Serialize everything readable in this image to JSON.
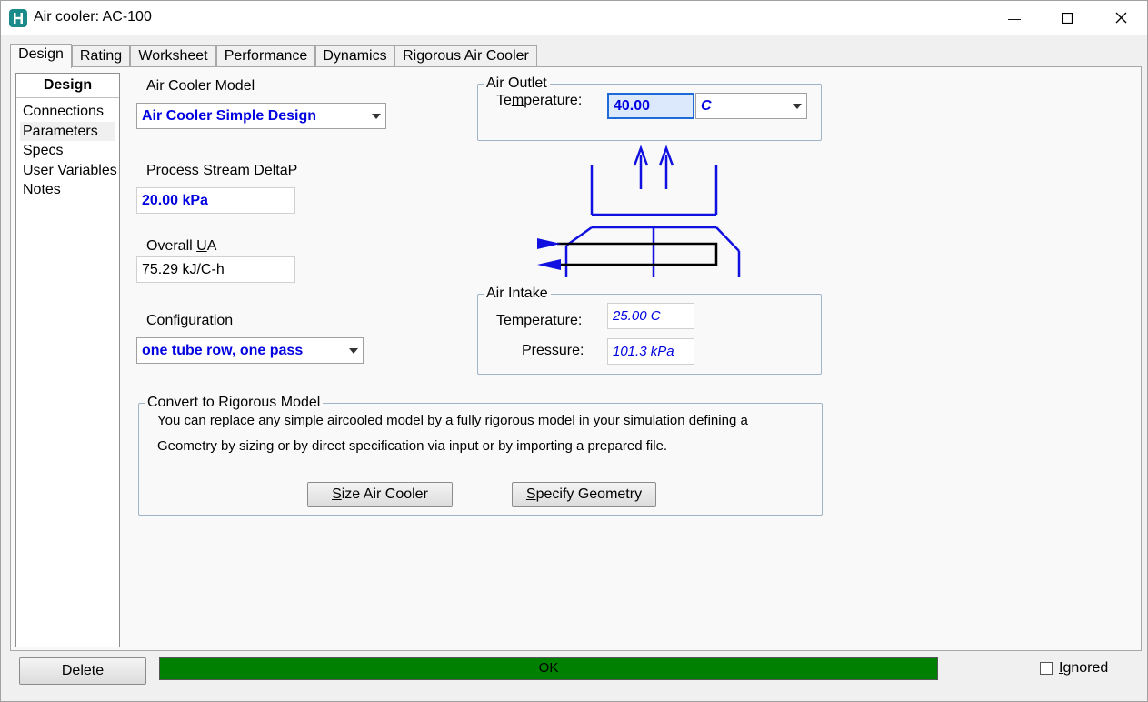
{
  "window": {
    "title": "Air cooler: AC-100",
    "minimize_glyph": "—",
    "maximize_glyph": "☐",
    "close_glyph": "✕"
  },
  "tabs": [
    {
      "label": "Design",
      "active": true
    },
    {
      "label": "Rating"
    },
    {
      "label": "Worksheet"
    },
    {
      "label": "Performance"
    },
    {
      "label": "Dynamics"
    },
    {
      "label": "Rigorous Air Cooler"
    }
  ],
  "nav": {
    "header": "Design",
    "items": [
      "Connections",
      "Parameters",
      "Specs",
      "User Variables",
      "Notes"
    ],
    "selected": "Parameters"
  },
  "model": {
    "label_pre": "Air Cooler Model",
    "value": "Air Cooler Simple Design"
  },
  "deltap": {
    "label_pre": "Process Stream ",
    "label_ul": "D",
    "label_post": "eltaP",
    "value": "20.00 kPa"
  },
  "ua": {
    "label_pre": "Overall ",
    "label_ul": "U",
    "label_post": "A",
    "value": "75.29 kJ/C-h"
  },
  "configuration": {
    "label_pre": "Co",
    "label_ul": "n",
    "label_post": "figuration",
    "value": "one tube row, one pass"
  },
  "air_outlet": {
    "legend": "Air Outlet",
    "temp_label_pre": "Te",
    "temp_label_ul": "m",
    "temp_label_post": "perature:",
    "temp_value": "40.00",
    "temp_unit": "C"
  },
  "air_intake": {
    "legend": "Air Intake",
    "temp_label_pre": "Temper",
    "temp_label_ul": "a",
    "temp_label_post": "ture:",
    "temp_value": "25.00 C",
    "pressure_label": "Pressure:",
    "pressure_value": "101.3 kPa"
  },
  "convert": {
    "legend": "Convert to Rigorous Model",
    "text_line1": "You can replace any simple aircooled model by a fully rigorous model in your simulation defining a",
    "text_line2": "Geometry by sizing or by direct specification via input or by importing a prepared file.",
    "size_btn_ul": "S",
    "size_btn_post": "ize Air Cooler",
    "specify_btn_ul": "S",
    "specify_btn_post": "pecify Geometry"
  },
  "footer": {
    "delete_label": "Delete",
    "status": "OK",
    "ignored_ul": "I",
    "ignored_post": "gnored"
  },
  "colors": {
    "diagram": "#1010e0",
    "status_ok": "#008000",
    "value_blue": "#0000e0"
  }
}
